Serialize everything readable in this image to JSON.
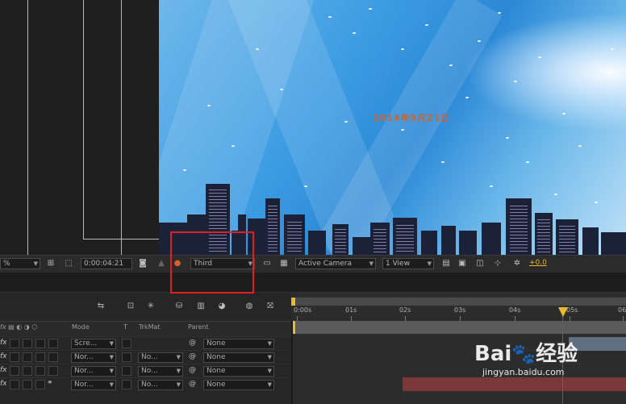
{
  "viewer": {
    "overlay_text": "2014年9月21日",
    "overlay_color": "#d2612b"
  },
  "toolbar": {
    "zoom_value": "%",
    "timecode": "0:00:04:21",
    "resolution": "Third",
    "camera": "Active Camera",
    "views": "1 View",
    "exposure": "+0.0",
    "highlight_color": "#e02020"
  },
  "timeline": {
    "columns": {
      "mode": "Mode",
      "t": "T",
      "trkmat": "TrkMat",
      "parent": "Parent"
    },
    "ruler_ticks": [
      "0:00s",
      "01s",
      "02s",
      "03s",
      "04s",
      "05s",
      "06"
    ],
    "current_time_indicator_seconds": 4.87,
    "layers": [
      {
        "fx": "fx",
        "mode": "Scre...",
        "trkmat": "",
        "parent": "None"
      },
      {
        "fx": "fx",
        "mode": "Nor...",
        "trkmat": "No...",
        "parent": "None"
      },
      {
        "fx": "fx",
        "mode": "Nor...",
        "trkmat": "No...",
        "parent": "None"
      },
      {
        "fx": "fx",
        "mode": "Nor...",
        "trkmat": "No...",
        "parent": "None"
      }
    ]
  },
  "watermark": {
    "brand": "Bai",
    "brand_suffix": "经验",
    "url": "jingyan.baidu.com"
  }
}
